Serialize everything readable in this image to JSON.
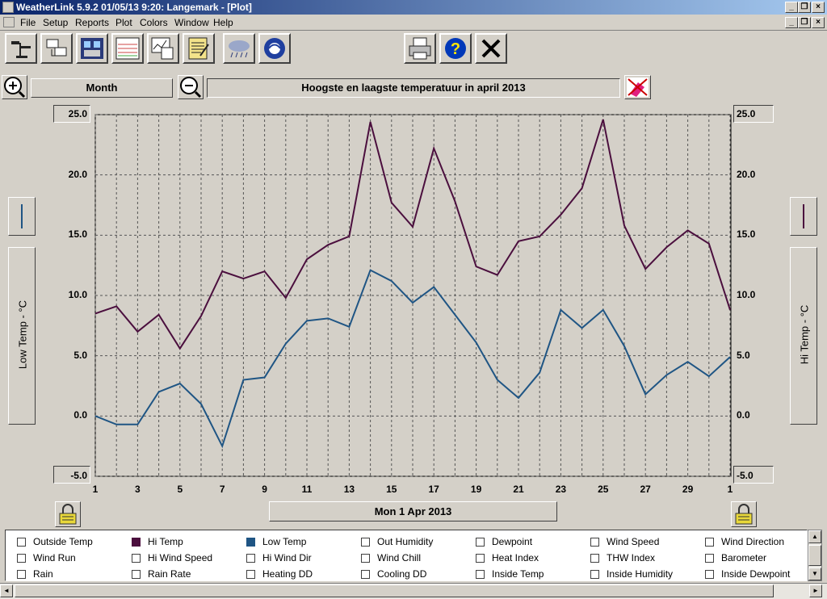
{
  "window": {
    "title": "WeatherLink 5.9.2  01/05/13  9:20: Langemark - [Plot]"
  },
  "menu": [
    "File",
    "Setup",
    "Reports",
    "Plot",
    "Colors",
    "Window",
    "Help"
  ],
  "toolbar": {
    "buttons": [
      "station-icon",
      "download-icon",
      "bulletin-icon",
      "strip-chart-icon",
      "plot-icon",
      "notepad-icon",
      "weather-icon",
      "noaa-icon"
    ],
    "print": "print-icon",
    "help": "?",
    "close": "✕"
  },
  "plot": {
    "zoom_in": "+",
    "zoom_out": "−",
    "period": "Month",
    "title": "Hoogste en laagste temperatuur in april 2013",
    "left_axis_label": "Low Temp - °C",
    "right_axis_label": "Hi Temp - °C",
    "date_label": "Mon 1 Apr 2013",
    "colors": {
      "hi": "#4b0f3e",
      "low": "#1f5584",
      "grid": "#555555"
    }
  },
  "chart_data": {
    "type": "line",
    "ylim": [
      -5.0,
      25.0
    ],
    "y_ticks": [
      "25.0",
      "20.0",
      "15.0",
      "10.0",
      "5.0",
      "0.0",
      "-5.0"
    ],
    "x_ticks": [
      "1",
      "3",
      "5",
      "7",
      "9",
      "11",
      "13",
      "15",
      "17",
      "19",
      "21",
      "23",
      "25",
      "27",
      "29",
      "1"
    ],
    "x": [
      1,
      2,
      3,
      4,
      5,
      6,
      7,
      8,
      9,
      10,
      11,
      12,
      13,
      14,
      15,
      16,
      17,
      18,
      19,
      20,
      21,
      22,
      23,
      24,
      25,
      26,
      27,
      28,
      29,
      30,
      31
    ],
    "series": [
      {
        "name": "Hi Temp",
        "values": [
          8.5,
          9.1,
          7.0,
          8.4,
          5.6,
          8.3,
          12.0,
          11.4,
          12.0,
          9.8,
          13.0,
          14.2,
          14.9,
          24.4,
          17.7,
          15.7,
          22.2,
          17.8,
          12.4,
          11.7,
          14.5,
          14.9,
          16.7,
          18.9,
          24.6,
          15.8,
          12.2,
          14.0,
          15.4,
          14.3,
          8.8
        ]
      },
      {
        "name": "Low Temp",
        "values": [
          0.0,
          -0.7,
          -0.7,
          2.0,
          2.7,
          1.0,
          -2.5,
          3.0,
          3.2,
          6.0,
          7.9,
          8.1,
          7.4,
          12.1,
          11.2,
          9.4,
          10.7,
          8.4,
          6.1,
          3.0,
          1.5,
          3.6,
          8.8,
          7.3,
          8.8,
          5.8,
          1.8,
          3.4,
          4.5,
          3.3,
          4.9
        ]
      }
    ]
  },
  "legend": [
    [
      {
        "label": "Outside Temp"
      },
      {
        "label": "Hi Temp",
        "color": "#4b0f3e"
      },
      {
        "label": "Low Temp",
        "color": "#1f5584"
      },
      {
        "label": "Out Humidity"
      },
      {
        "label": "Dewpoint"
      },
      {
        "label": "Wind Speed"
      },
      {
        "label": "Wind Direction"
      }
    ],
    [
      {
        "label": "Wind Run"
      },
      {
        "label": "Hi Wind Speed"
      },
      {
        "label": "Hi Wind Dir"
      },
      {
        "label": "Wind Chill"
      },
      {
        "label": "Heat Index"
      },
      {
        "label": "THW Index"
      },
      {
        "label": "Barometer"
      }
    ],
    [
      {
        "label": "Rain"
      },
      {
        "label": "Rain Rate"
      },
      {
        "label": "Heating DD"
      },
      {
        "label": "Cooling DD"
      },
      {
        "label": "Inside Temp"
      },
      {
        "label": "Inside Humidity"
      },
      {
        "label": "Inside Dewpoint"
      }
    ]
  ]
}
